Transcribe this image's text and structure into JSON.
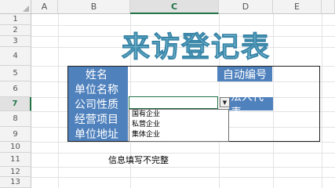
{
  "columns": [
    "A",
    "B",
    "C",
    "D",
    "E"
  ],
  "rows": [
    "1",
    "2",
    "3",
    "4",
    "5",
    "6",
    "7",
    "8",
    "9",
    "10",
    "11",
    "12",
    "13"
  ],
  "active_cell": {
    "column": "C",
    "row": "7"
  },
  "title": "来访登记表",
  "form_labels": [
    "姓名",
    "单位名称",
    "公司性质",
    "经营项目",
    "单位地址"
  ],
  "right_labels": {
    "auto_number": "自动编号",
    "legal_rep": "法人代表"
  },
  "dropdown": {
    "toggle_icon": "dropdown-arrow-icon",
    "options": [
      "国有企业",
      "私营企业",
      "集体企业"
    ]
  },
  "message": "信息填写不完整",
  "colors": {
    "label_fill": "#4f81bd",
    "title_fill": "#9fd7ea",
    "title_outline": "#3a86a8",
    "selection": "#217346"
  }
}
